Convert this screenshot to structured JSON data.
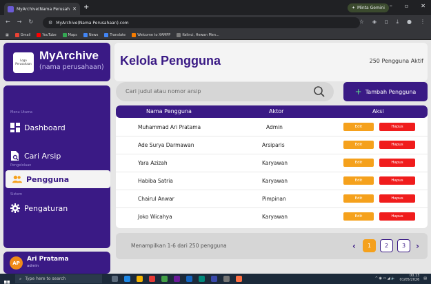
{
  "browser": {
    "tab_title": "MyArchive(Nama Perusahaan)",
    "tab_close": "✕",
    "new_tab": "+",
    "profile_chip": "Minta Gemini",
    "url": "MyArchive(Nama Perusahaan).com",
    "bookmarks": [
      {
        "label": "Gmail",
        "color": "#ea4335"
      },
      {
        "label": "YouTube",
        "color": "#ff0000"
      },
      {
        "label": "Maps",
        "color": "#34a853"
      },
      {
        "label": "News",
        "color": "#4285f4"
      },
      {
        "label": "Translate",
        "color": "#4285f4"
      },
      {
        "label": "Welcome to XAMPP",
        "color": "#f57c00"
      },
      {
        "label": "Kelinci, Hewan Men...",
        "color": "#7c7c7c"
      }
    ]
  },
  "brand": {
    "logo_text": "Logo Perusahaan",
    "name": "MyArchive",
    "subtitle": "(nama perusahaan)"
  },
  "sidebar": {
    "section_main": "Menu Utama",
    "section_manage": "Pengelolaan",
    "section_system": "Sistem",
    "items": {
      "dashboard": "Dashboard",
      "cari_arsip": "Cari Arsip",
      "pengguna": "Pengguna",
      "pengaturan": "Pengaturan"
    }
  },
  "user": {
    "initials": "AP",
    "name": "Ari Pratama",
    "role": "admin"
  },
  "header": {
    "title": "Kelola Pengguna",
    "active_count": "250 Pengguna Aktif"
  },
  "search": {
    "placeholder": "Cari judul atau nomor arsip"
  },
  "add_button": {
    "label": "Tambah Pengguna"
  },
  "table": {
    "columns": {
      "name": "Nama Pengguna",
      "role": "Aktor",
      "action": "Aksi"
    },
    "edit_label": "Edit",
    "delete_label": "Hapus",
    "rows": [
      {
        "name": "Muhammad Ari Pratama",
        "role": "Admin"
      },
      {
        "name": "Ade Surya Darmawan",
        "role": "Arsiparis"
      },
      {
        "name": "Yara Azizah",
        "role": "Karyawan"
      },
      {
        "name": "Habiba Satria",
        "role": "Karyawan"
      },
      {
        "name": "Chairul Anwar",
        "role": "Pimpinan"
      },
      {
        "name": "Joko Wicahya",
        "role": "Karyawan"
      }
    ]
  },
  "pagination": {
    "summary": "Menampilkan 1-6 dari 250 pengguna",
    "prev": "‹",
    "next": "›",
    "pages": [
      "1",
      "2",
      "3"
    ]
  },
  "taskbar": {
    "search_placeholder": "Type here to search",
    "time": "00.13",
    "date": "01/05/2026"
  },
  "colors": {
    "primary": "#3a1a85",
    "accent_orange": "#f5a11c",
    "danger": "#f01c1c"
  }
}
